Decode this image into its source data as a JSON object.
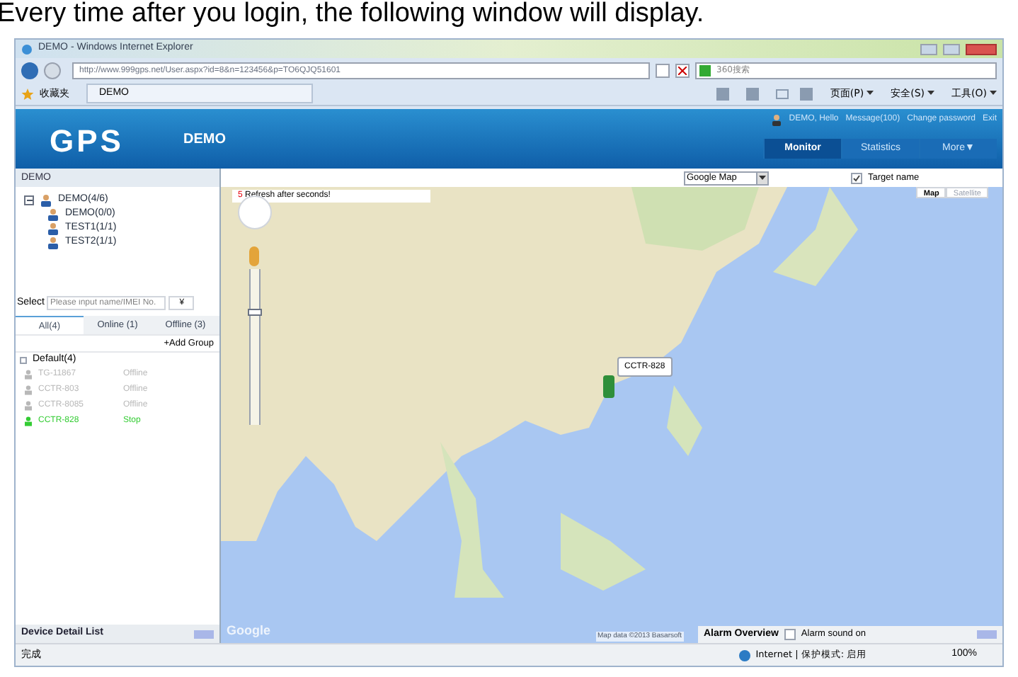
{
  "caption": "Every time after you login, the following window will display.",
  "browser": {
    "title": "DEMO - Windows Internet Explorer",
    "address": "http://www.999gps.net/User.aspx?id=8&n=123456&p=TO6QJQ51601",
    "search_placeholder": "360搜索",
    "favorites": "收藏夹",
    "tab": "DEMO",
    "tools": [
      "页面(P)",
      "安全(S)",
      "工具(O)"
    ],
    "status_left": "完成",
    "zone": "Internet | 保护模式: 启用",
    "zoom": "100%"
  },
  "app": {
    "logo": "GPS",
    "account": "DEMO",
    "user_links": [
      "DEMO, Hello",
      "Message(100)",
      "Change password",
      "Exit"
    ],
    "nav": [
      {
        "label": "Monitor",
        "selected": true
      },
      {
        "label": "Statistics",
        "selected": false
      },
      {
        "label": "More▼",
        "selected": false
      }
    ]
  },
  "left": {
    "title": "DEMO",
    "tree": [
      {
        "label": "DEMO(4/6)",
        "expanded": true,
        "children": [
          {
            "label": "DEMO(0/0)"
          },
          {
            "label": "TEST1(1/1)"
          },
          {
            "label": "TEST2(1/1)"
          }
        ]
      }
    ],
    "select_label": "Select",
    "select_placeholder": "Please input name/IMEI No.",
    "select_button": "¥",
    "filters": [
      {
        "label": "All(4)",
        "selected": true
      },
      {
        "label": "Online (1)",
        "selected": false
      },
      {
        "label": "Offline (3)",
        "selected": false
      }
    ],
    "add_group": "+Add Group",
    "group": "Default(4)",
    "devices": [
      {
        "name": "TG-11867",
        "status": "Offline",
        "color": "#b8b8b8"
      },
      {
        "name": "CCTR-803",
        "status": "Offline",
        "color": "#b8b8b8"
      },
      {
        "name": "CCTR-8085",
        "status": "Offline",
        "color": "#b8b8b8"
      },
      {
        "name": "CCTR-828",
        "status": "Stop",
        "color": "#33cc33"
      }
    ],
    "footer": "Device Detail List"
  },
  "map": {
    "map_type": "Google Map",
    "target_name": {
      "label": "Target name",
      "checked": true
    },
    "refresh_count": "5",
    "refresh_text": "Refresh after seconds!",
    "map_buttons": [
      {
        "label": "Map",
        "selected": true
      },
      {
        "label": "Satellite",
        "selected": false
      }
    ],
    "zoom_level": {
      "level": 0.75
    },
    "marker_label": "CCTR-828",
    "attribution": "Map data ©2013 Basarsoft",
    "logo": "Google",
    "alarm": {
      "title": "Alarm Overview",
      "sound": {
        "label": "Alarm sound on",
        "checked": false
      }
    }
  }
}
